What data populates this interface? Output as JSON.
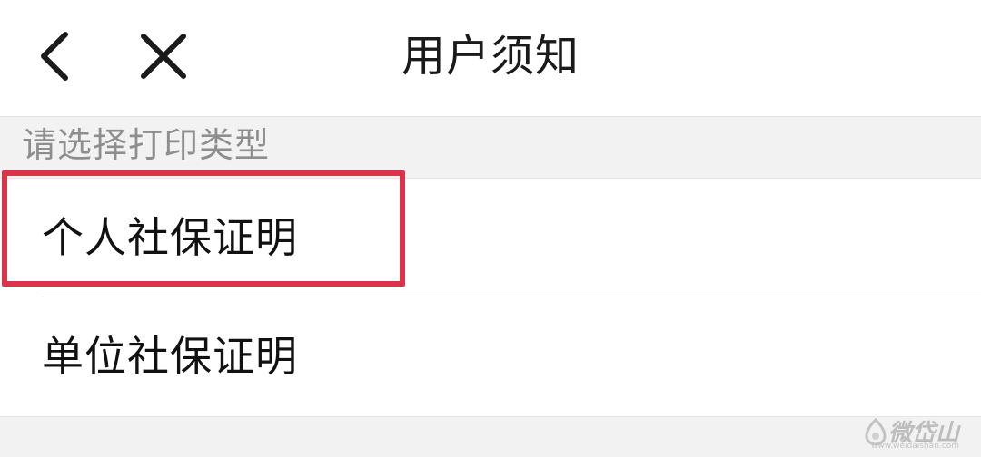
{
  "nav": {
    "title": "用户须知",
    "back_icon": "chevron-left-icon",
    "close_icon": "close-icon"
  },
  "section": {
    "header": "请选择打印类型"
  },
  "list": {
    "items": [
      {
        "label": "个人社保证明",
        "highlighted": true
      },
      {
        "label": "单位社保证明",
        "highlighted": false
      }
    ]
  },
  "highlight": {
    "color": "#d9344a"
  },
  "watermark": {
    "text": "微岱山",
    "sub": "www.weidaishan.com"
  }
}
